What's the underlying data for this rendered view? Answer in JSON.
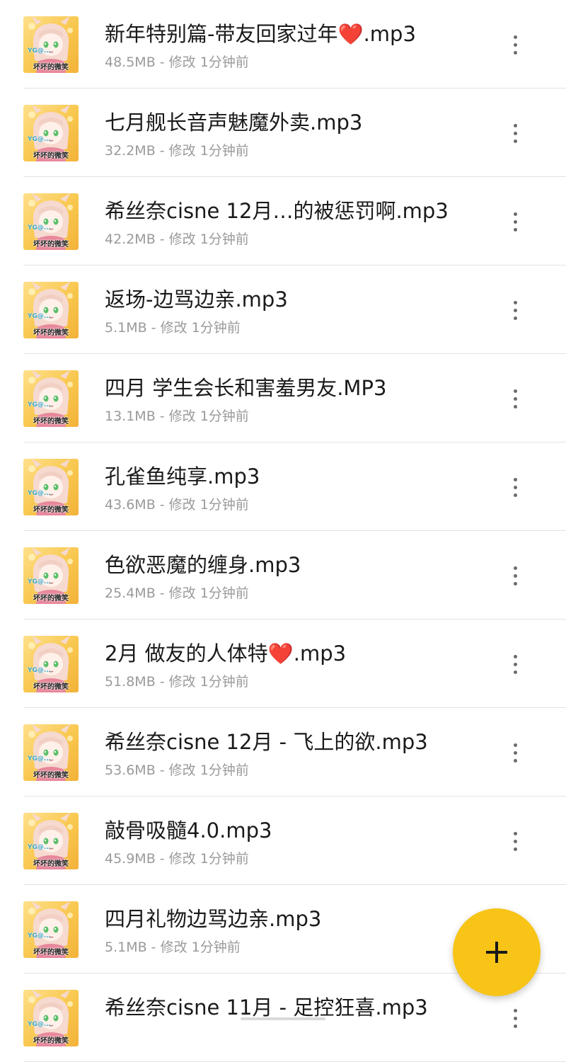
{
  "files": [
    {
      "name": "新年特别篇-带友回家过年❤️.mp3",
      "meta": "48.5MB - 修改 1分钟前"
    },
    {
      "name": "七月舰长音声魅魔外卖.mp3",
      "meta": "32.2MB - 修改 1分钟前"
    },
    {
      "name": "希丝奈cisne 12月…的被惩罚啊.mp3",
      "meta": "42.2MB - 修改 1分钟前"
    },
    {
      "name": "返场-边骂边亲.mp3",
      "meta": "5.1MB - 修改 1分钟前"
    },
    {
      "name": "四月 学生会长和害羞男友.MP3",
      "meta": "13.1MB - 修改 1分钟前"
    },
    {
      "name": "孔雀鱼纯享.mp3",
      "meta": "43.6MB - 修改 1分钟前"
    },
    {
      "name": "色欲恶魔的缠身.mp3",
      "meta": "25.4MB - 修改 1分钟前"
    },
    {
      "name": "2月 做友的人体特❤️.mp3",
      "meta": "51.8MB - 修改 1分钟前"
    },
    {
      "name": "希丝奈cisne 12月 - 飞上的欲.mp3",
      "meta": "53.6MB - 修改 1分钟前"
    },
    {
      "name": "敲骨吸髓4.0.mp3",
      "meta": "45.9MB - 修改 1分钟前"
    },
    {
      "name": "四月礼物边骂边亲.mp3",
      "meta": "5.1MB - 修改 1分钟前"
    },
    {
      "name": "希丝奈cisne 11月 - 足控狂喜.mp3",
      "meta": ""
    }
  ],
  "thumbnail": {
    "caption": "坏坏的微笑",
    "watermark": "YG@..."
  },
  "icons": {
    "more": "more-vertical-icon",
    "add": "plus-icon"
  },
  "colors": {
    "fab": "#f7c417",
    "meta_text": "#9a9a9a",
    "divider": "#e2e2e2"
  }
}
